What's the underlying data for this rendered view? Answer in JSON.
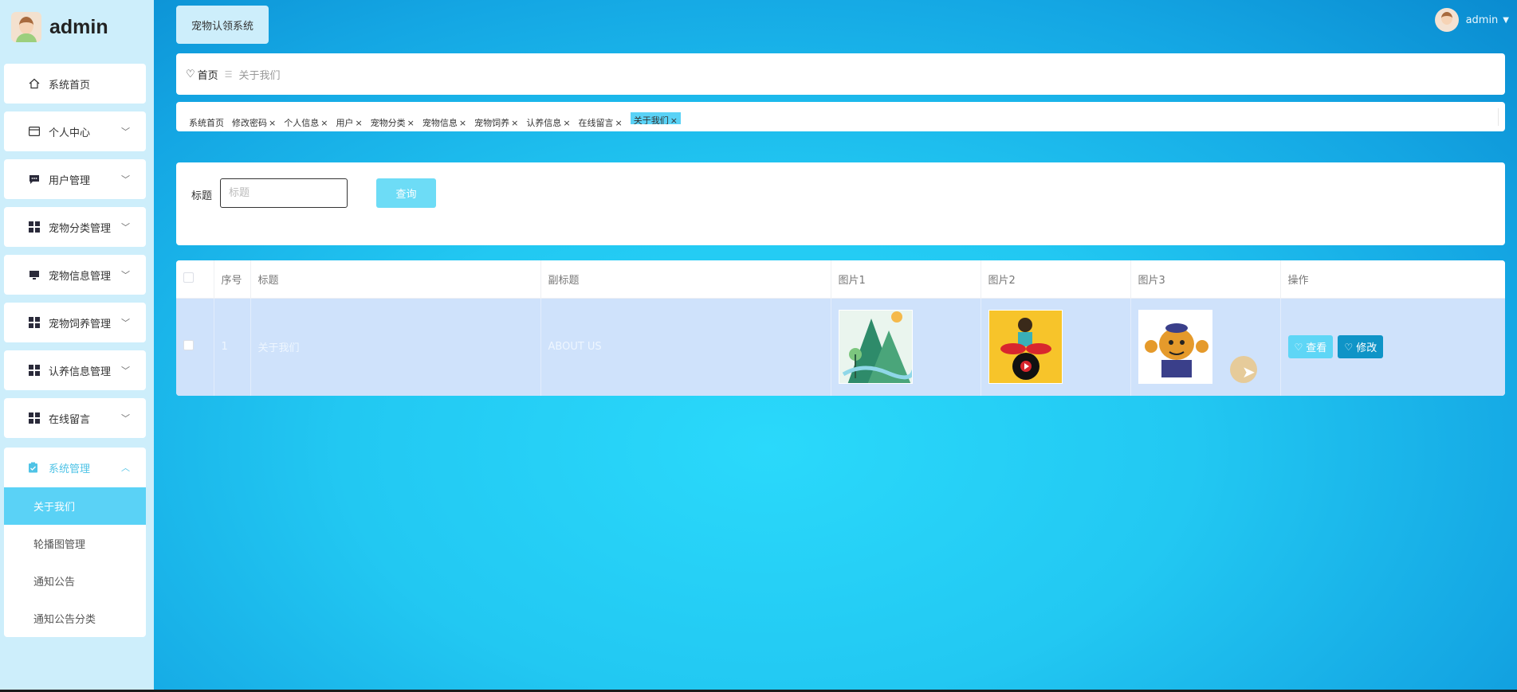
{
  "brand": {
    "name": "admin"
  },
  "sidebar": {
    "items": [
      {
        "label": "系统首页",
        "icon": "home-icon"
      },
      {
        "label": "个人中心",
        "icon": "card-icon"
      },
      {
        "label": "用户管理",
        "icon": "chat-icon"
      },
      {
        "label": "宠物分类管理",
        "icon": "grid-icon"
      },
      {
        "label": "宠物信息管理",
        "icon": "monitor-icon"
      },
      {
        "label": "宠物饲养管理",
        "icon": "grid-icon"
      },
      {
        "label": "认养信息管理",
        "icon": "grid-icon"
      },
      {
        "label": "在线留言",
        "icon": "grid-icon"
      }
    ],
    "group": {
      "label": "系统管理",
      "icon": "clipboard-icon",
      "subs": [
        "关于我们",
        "轮播图管理",
        "通知公告",
        "通知公告分类"
      ]
    }
  },
  "header": {
    "system_title": "宠物认领系统",
    "user": "admin"
  },
  "breadcrumb": {
    "home": "首页",
    "current": "关于我们"
  },
  "tags": [
    {
      "label": "系统首页",
      "closable": false
    },
    {
      "label": "修改密码",
      "closable": true
    },
    {
      "label": "个人信息",
      "closable": true
    },
    {
      "label": "用户",
      "closable": true
    },
    {
      "label": "宠物分类",
      "closable": true
    },
    {
      "label": "宠物信息",
      "closable": true
    },
    {
      "label": "宠物饲养",
      "closable": true
    },
    {
      "label": "认养信息",
      "closable": true
    },
    {
      "label": "在线留言",
      "closable": true
    },
    {
      "label": "关于我们",
      "closable": true,
      "active": true
    }
  ],
  "search": {
    "label": "标题",
    "placeholder": "标题",
    "button": "查询"
  },
  "table": {
    "columns": [
      "序号",
      "标题",
      "副标题",
      "图片1",
      "图片2",
      "图片3",
      "操作"
    ],
    "rows": [
      {
        "index": "1",
        "title": "关于我们",
        "subtitle": "ABOUT US",
        "view": "查看",
        "edit": "修改"
      }
    ]
  },
  "colors": {
    "accent": "#5ad2f6",
    "primary": "#0f94c7",
    "sidebar_bg": "#cdeefb"
  }
}
